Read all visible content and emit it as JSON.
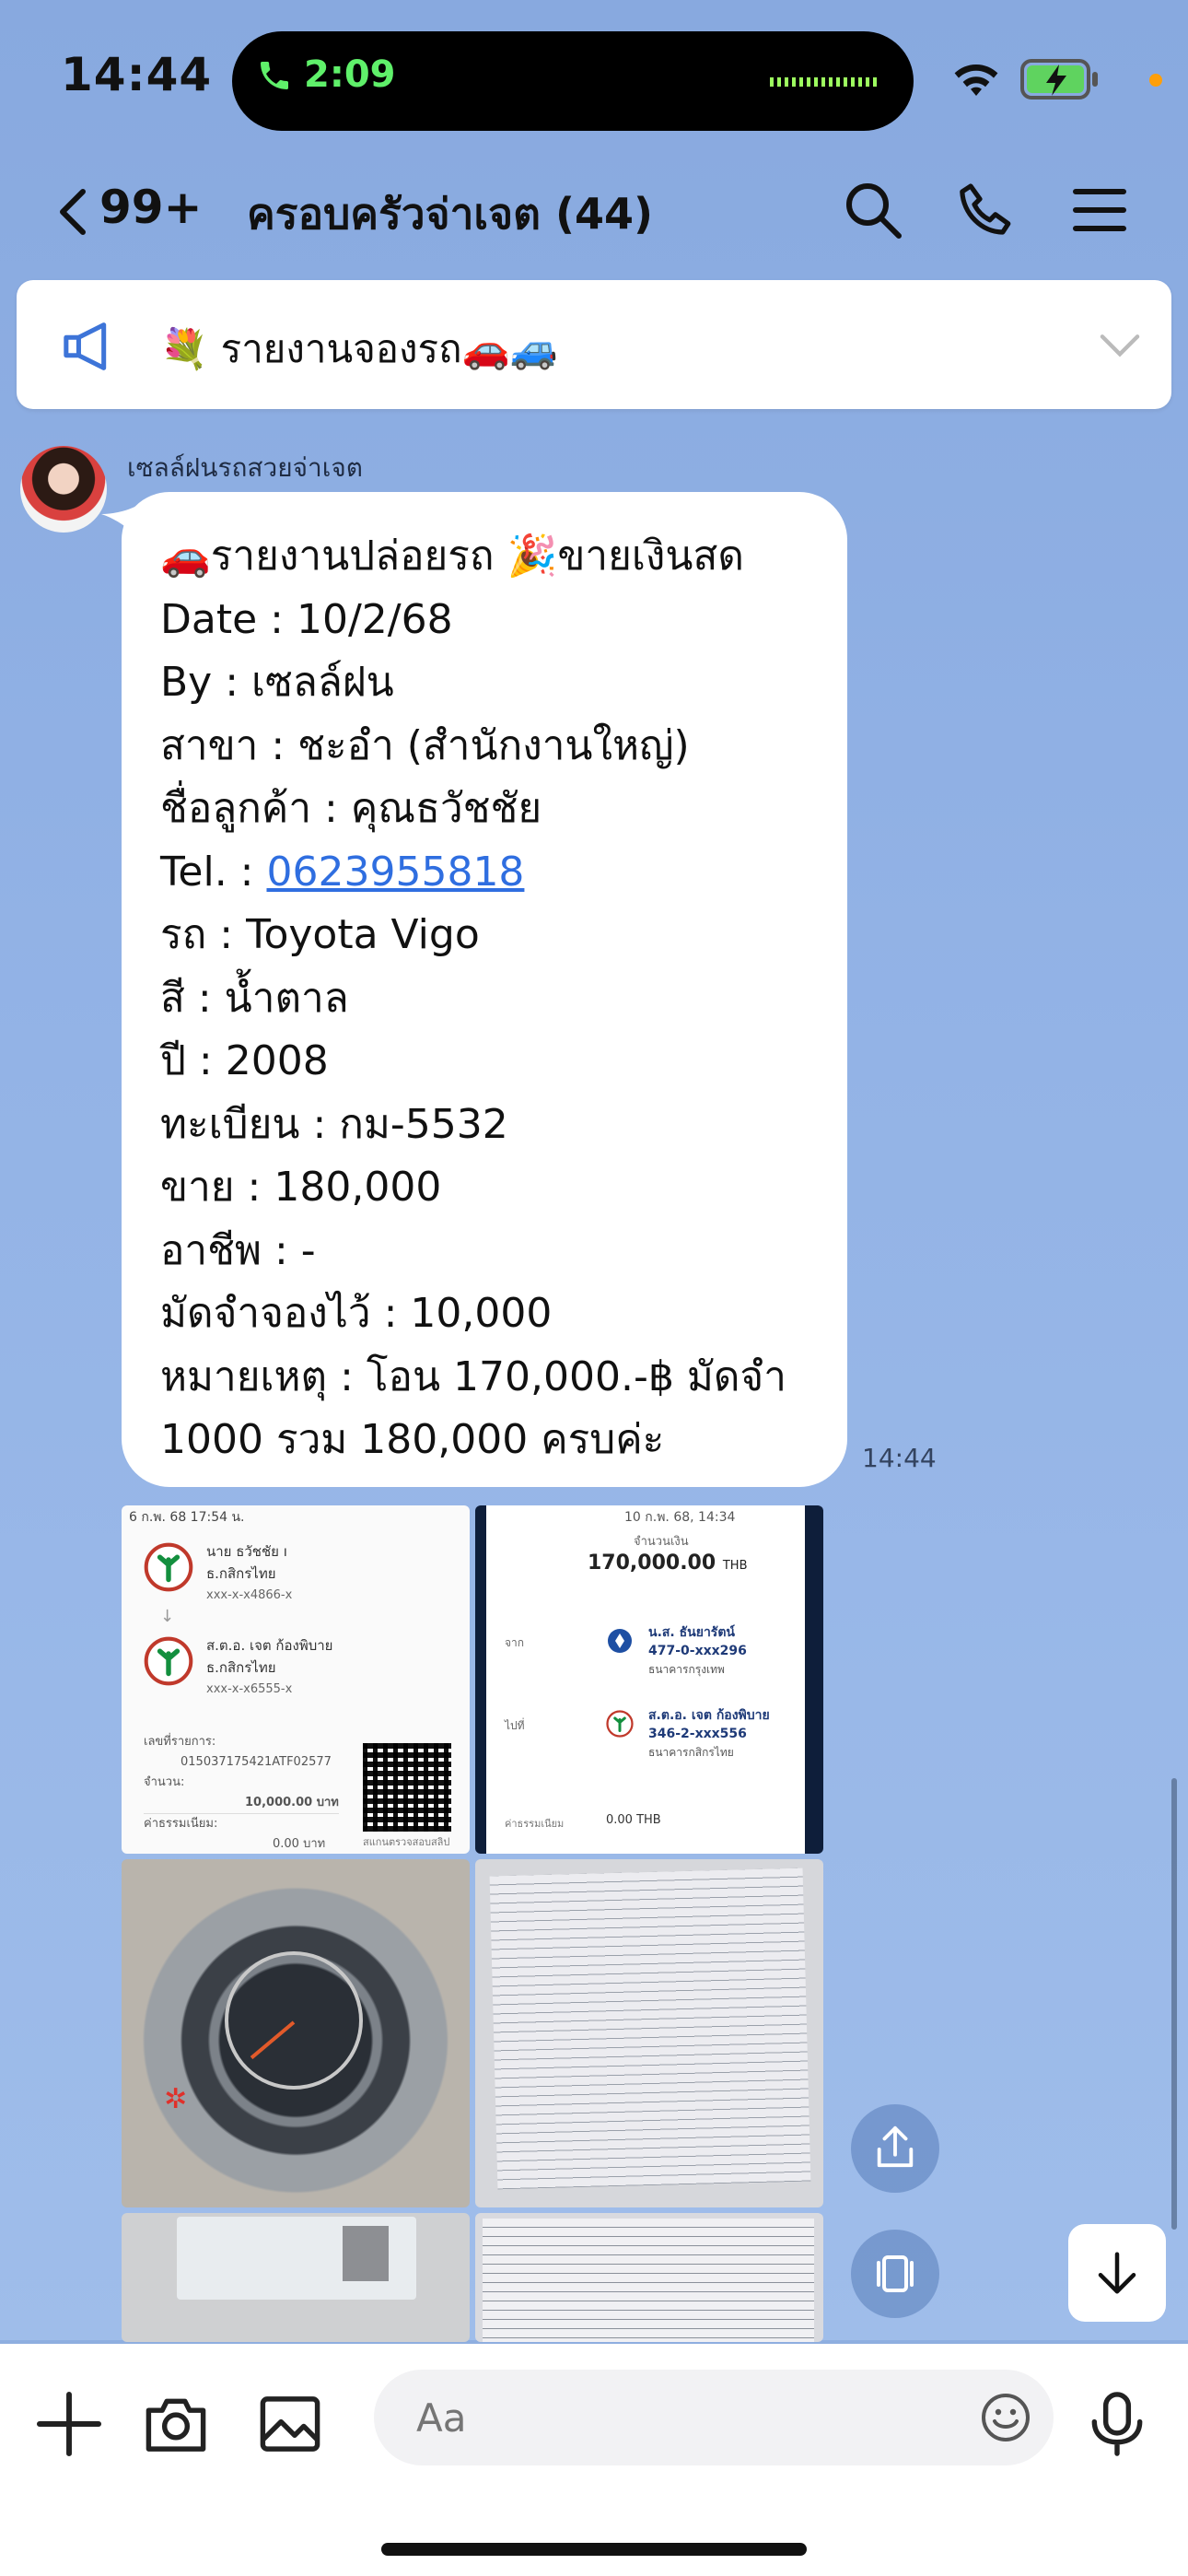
{
  "status_bar": {
    "time": "14:44",
    "call_time": "2:09"
  },
  "header": {
    "unread_count": "99+",
    "title": "ครอบครัวจ่าเจต (44)"
  },
  "announcement": {
    "text": "💐 รายงานจองรถ🚗🚙"
  },
  "message": {
    "sender": "เซลล์ฝนรถสวยจ่าเจต",
    "lines": [
      "🚗รายงานปล่อยรถ 🎉ขายเงินสด",
      "Date : 10/2/68",
      "By : เซลล์ฝน",
      "สาขา : ชะอำ (สำนักงานใหญ่)",
      "ชื่อลูกค้า : คุณธวัชชัย",
      "รถ : Toyota Vigo",
      "สี : น้ำตาล",
      "ปี : 2008",
      "ทะเบียน : กม-5532",
      "ขาย : 180,000",
      "อาชีพ : -",
      "มัดจำจองไว้ : 10,000",
      "หมายเหตุ : โอน 170,000.-฿ มัดจำ 1000 รวม 180,000 ครบค่ะ"
    ],
    "tel_label": "Tel. : ",
    "tel_number": "0623955818",
    "time": "14:44"
  },
  "slip1": {
    "date": "6 ก.พ. 68  17:54 น.",
    "from_name": "นาย ธวัชชัย ı",
    "from_bank": "ธ.กสิกรไทย",
    "from_acct": "xxx-x-x4866-x",
    "to_name": "ส.ต.อ. เจต ก้องพิบาย",
    "to_bank": "ธ.กสิกรไทย",
    "to_acct": "xxx-x-x6555-x",
    "ref_label": "เลขที่รายการ:",
    "ref": "015037175421ATF02577",
    "amount_label": "จำนวน:",
    "amount": "10,000.00 บาท",
    "fee_label": "ค่าธรรมเนียม:",
    "fee": "0.00 บาท",
    "scan_label": "สแกนตรวจสอบสลิป"
  },
  "slip2": {
    "date": "10 ก.พ. 68, 14:34",
    "amount_label": "จำนวนเงิน",
    "amount": "170,000.00",
    "currency": "THB",
    "from_label": "จาก",
    "from_name": "น.ส. ธันยารัตน์",
    "from_acct": "477-0-xxx296",
    "from_bank": "ธนาคารกรุงเทพ",
    "to_label": "ไปที่",
    "to_name": "ส.ต.อ. เจต ก้องพิบาย",
    "to_acct": "346-2-xxx556",
    "to_bank": "ธนาคารกสิกรไทย",
    "fee_label": "ค่าธรรมเนียม",
    "fee": "0.00 THB"
  },
  "input": {
    "placeholder": "Aa"
  }
}
